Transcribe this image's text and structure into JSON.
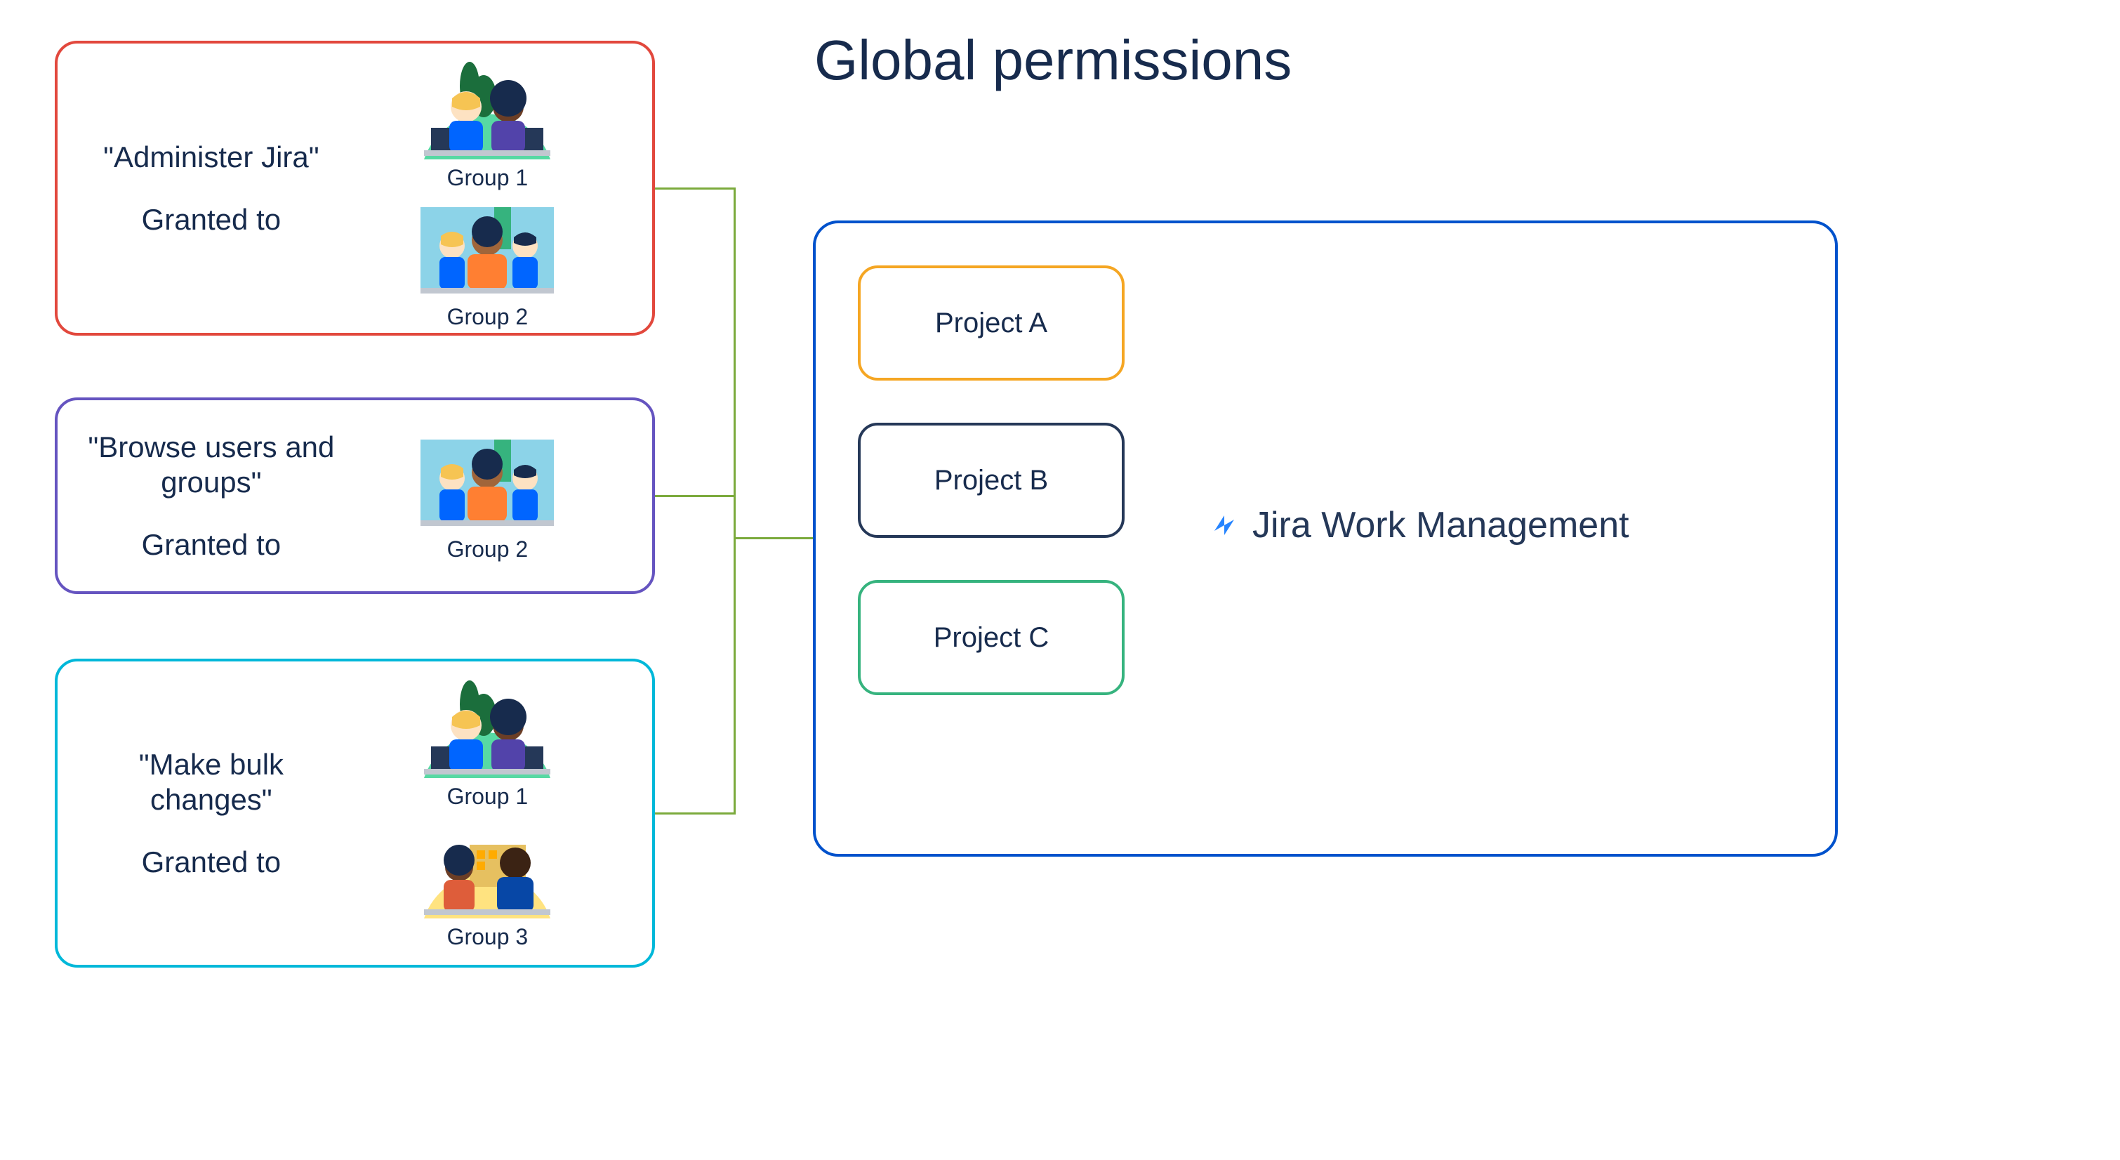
{
  "title": "Global permissions",
  "permissions": [
    {
      "name": "\"Administer Jira\"",
      "granted_label": "Granted to",
      "groups": [
        "Group 1",
        "Group 2"
      ],
      "border_color": "#E2483D"
    },
    {
      "name": "\"Browse users and groups\"",
      "granted_label": "Granted to",
      "groups": [
        "Group 2"
      ],
      "border_color": "#6554C0"
    },
    {
      "name": "\"Make bulk changes\"",
      "granted_label": "Granted to",
      "groups": [
        "Group 1",
        "Group 3"
      ],
      "border_color": "#00B8D9"
    }
  ],
  "product": {
    "name": "Jira Work Management",
    "projects": [
      {
        "label": "Project A",
        "border_color": "#F5A623"
      },
      {
        "label": "Project B",
        "border_color": "#253858"
      },
      {
        "label": "Project C",
        "border_color": "#36B37E"
      }
    ]
  },
  "group_art_variants": {
    "Group 1": "green-round-two-people",
    "Group 2": "teal-square-three-people",
    "Group 3": "yellow-round-two-people"
  }
}
